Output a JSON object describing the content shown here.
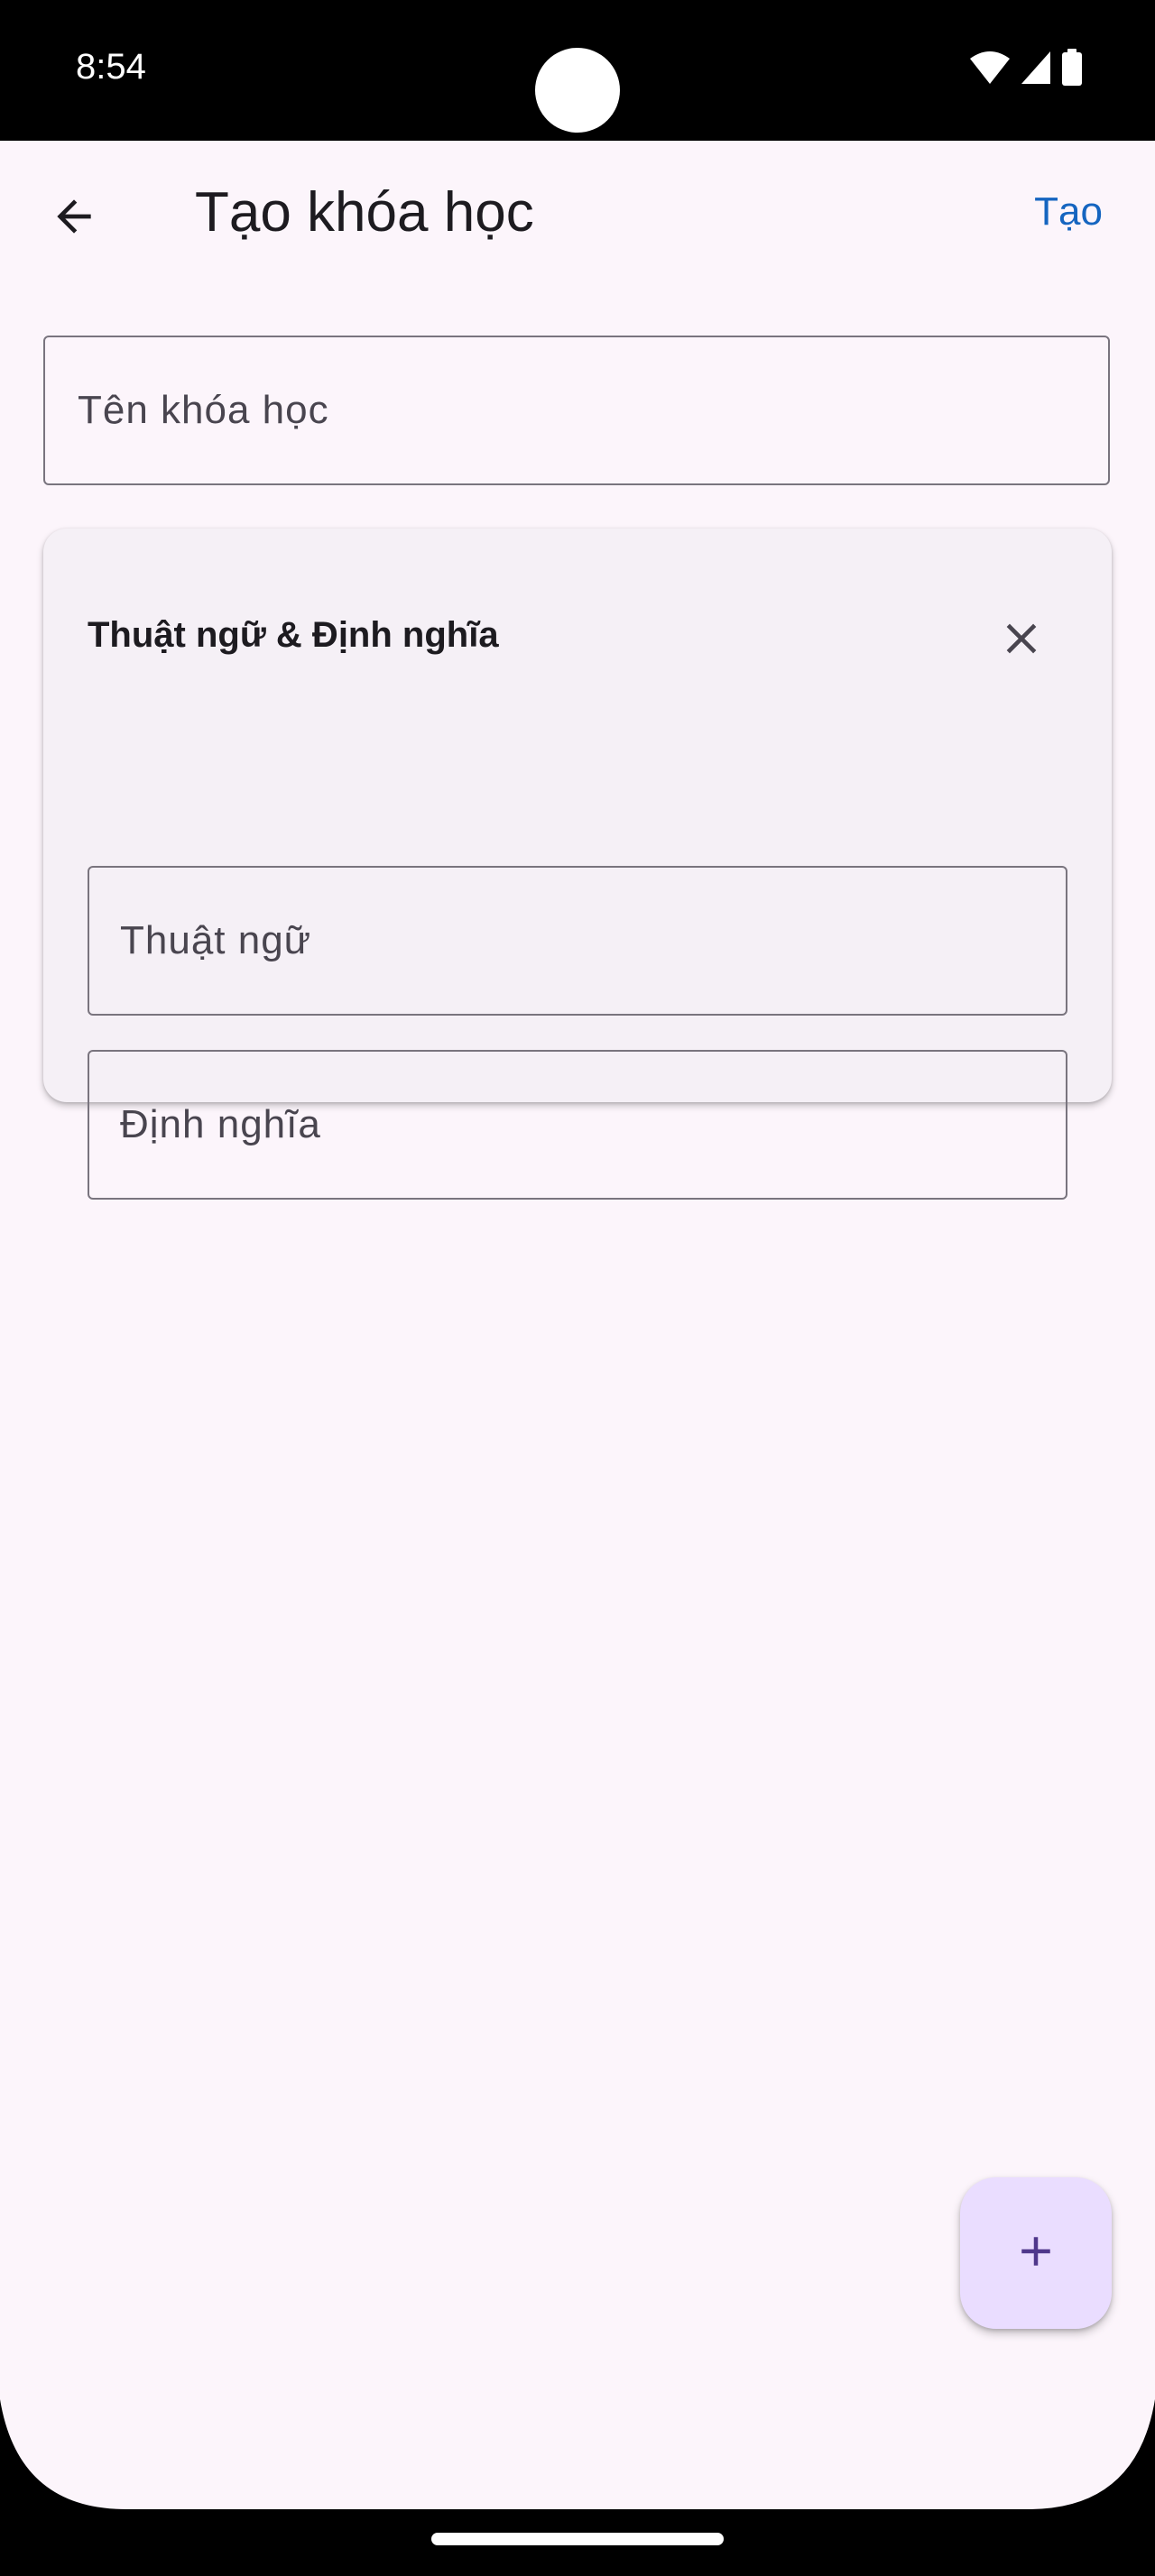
{
  "status_bar": {
    "time": "8:54",
    "icons": [
      "wifi-icon",
      "cellular-signal-icon",
      "battery-icon"
    ]
  },
  "app_bar": {
    "back_icon": "arrow-back-icon",
    "title": "Tạo khóa học",
    "action_label": "Tạo"
  },
  "form": {
    "course_name_placeholder": "Tên khóa học"
  },
  "card": {
    "title": "Thuật ngữ & Định nghĩa",
    "close_icon": "close-icon",
    "term_placeholder": "Thuật ngữ",
    "definition_placeholder": "Định nghĩa"
  },
  "fab": {
    "icon": "plus-icon"
  },
  "colors": {
    "background": "#fcf5fb",
    "accent_link": "#1565c0",
    "card_background": "#f5f0f6",
    "fab_background": "#eaddff",
    "fab_icon": "#4f378b",
    "outline": "#79747e"
  }
}
